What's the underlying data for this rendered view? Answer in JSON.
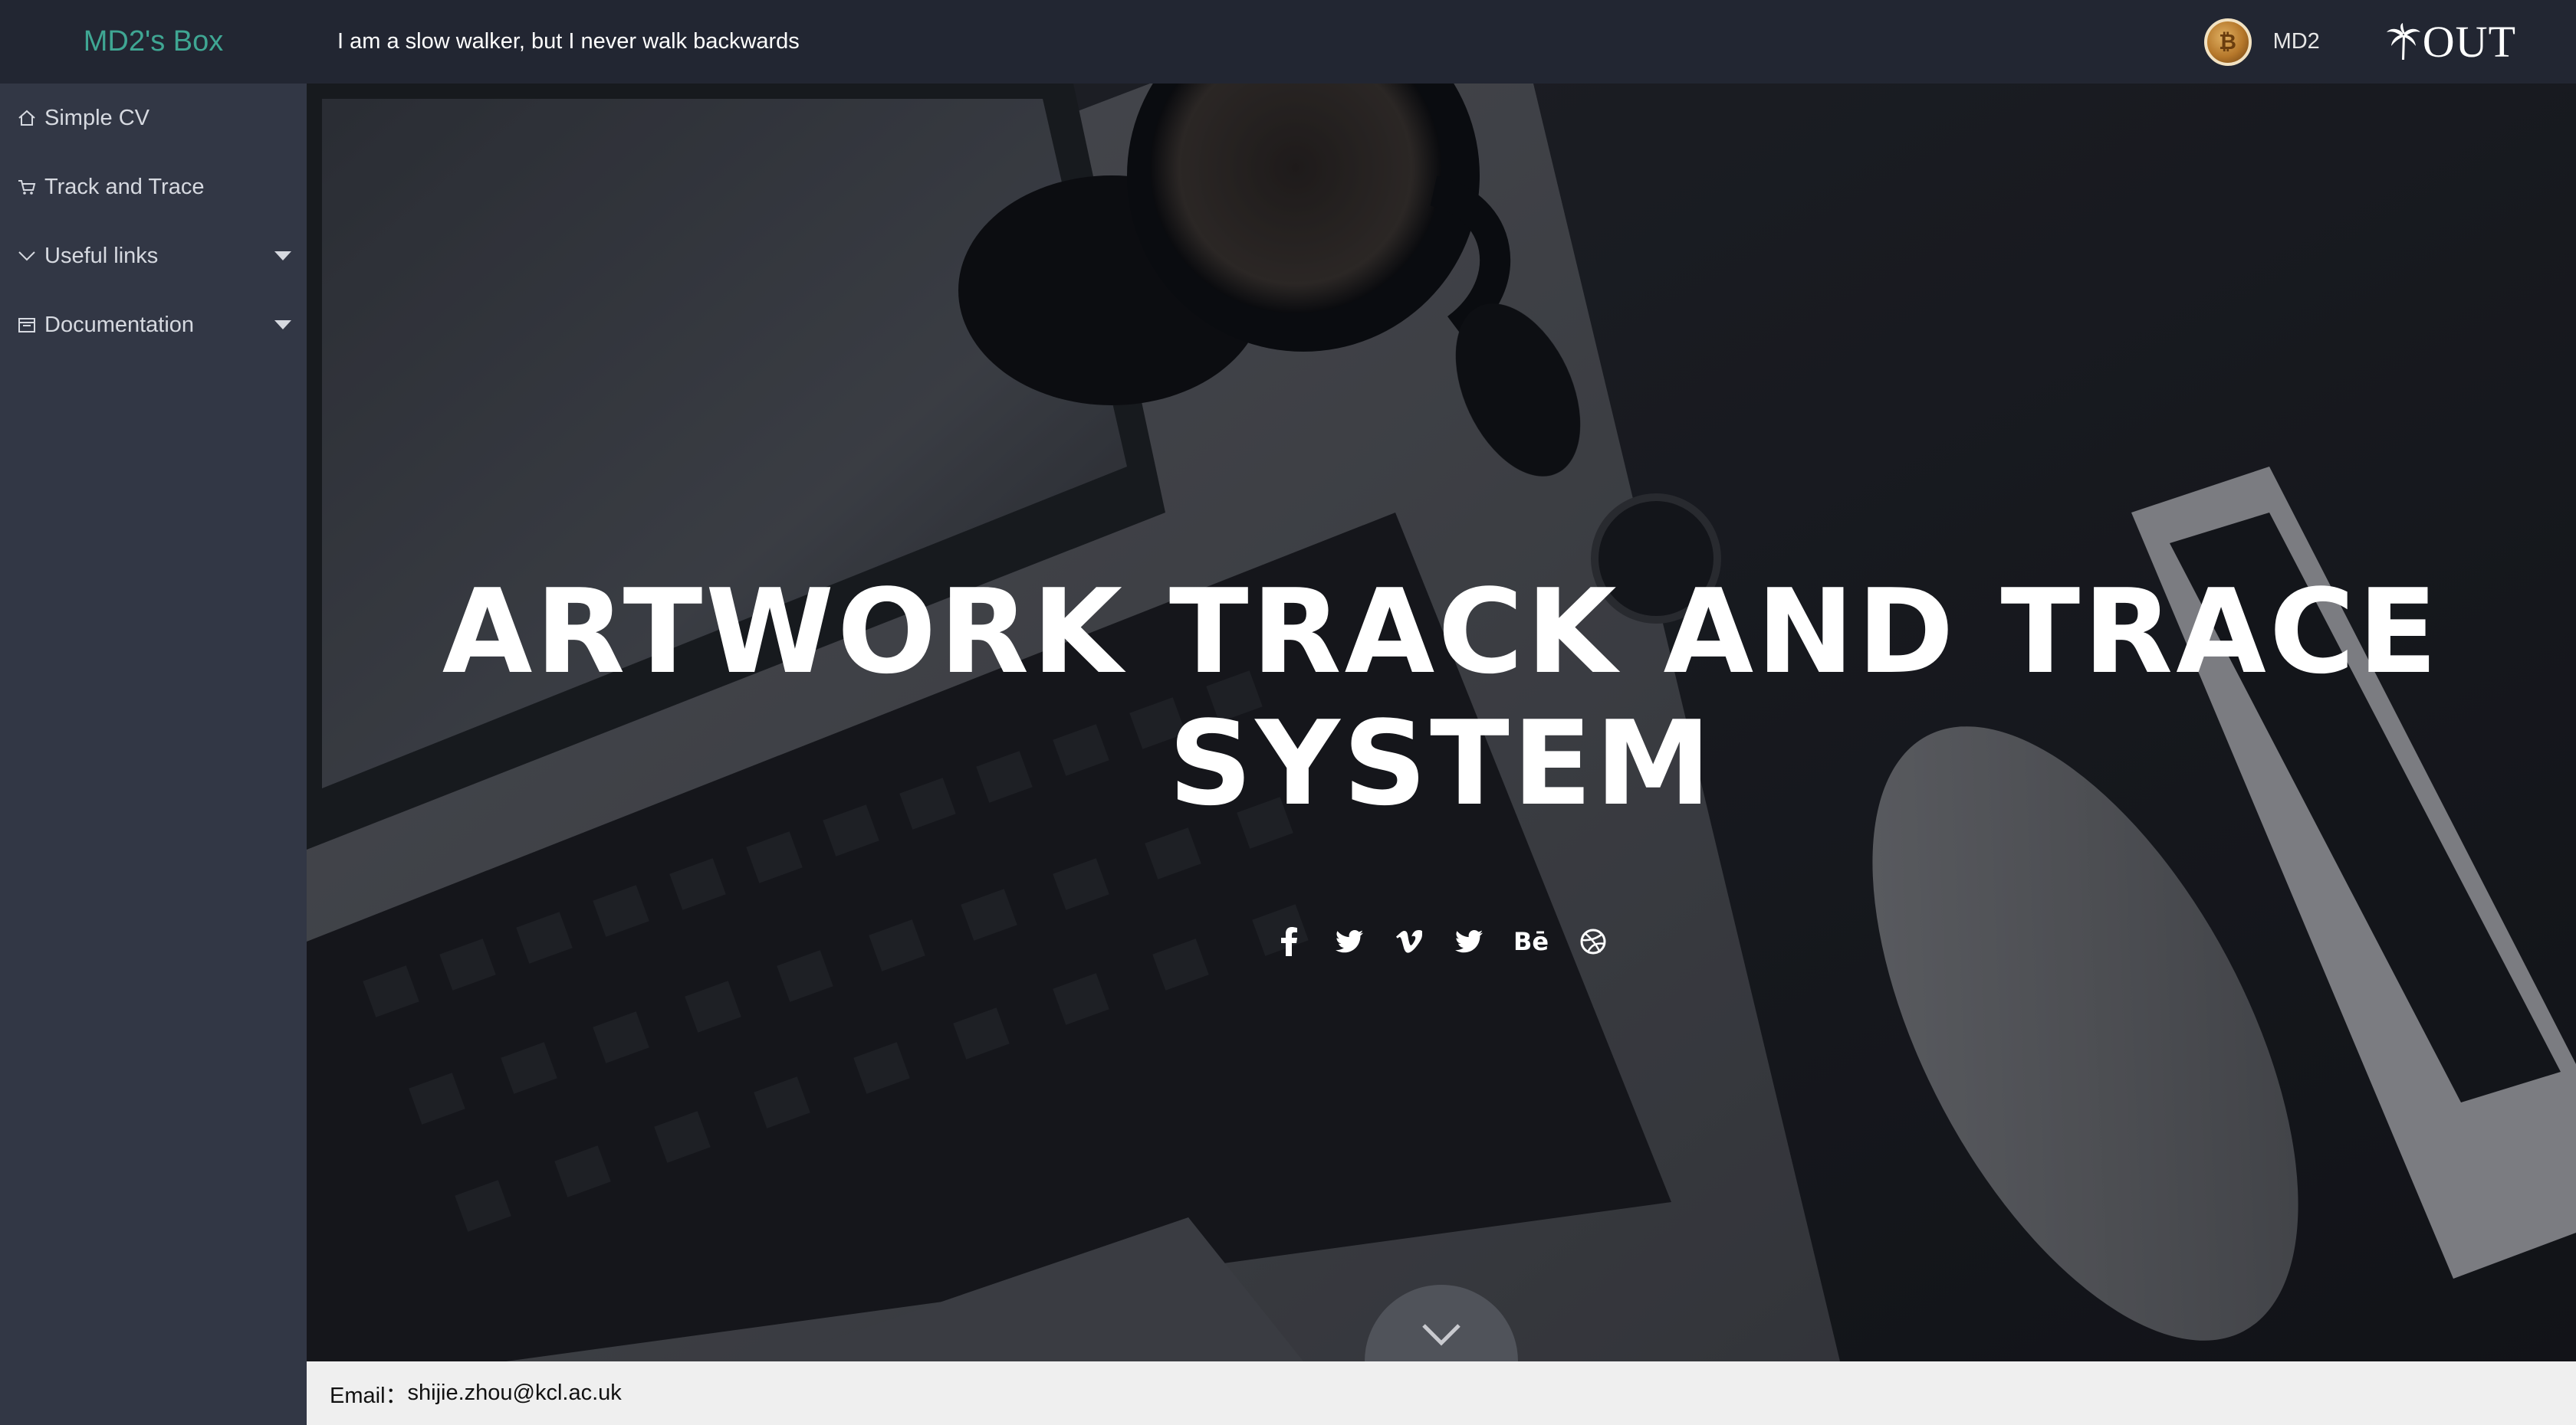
{
  "header": {
    "brand": "MD2's Box",
    "motto": "I am a slow walker, but I never walk backwards",
    "user": {
      "avatar_glyph": "₿",
      "name": "MD2"
    },
    "logout_label": "OUT",
    "logout_icon": "palm-tree-icon"
  },
  "sidebar": {
    "items": [
      {
        "label": "Simple CV",
        "icon": "home-icon",
        "has_submenu": false
      },
      {
        "label": "Track and Trace",
        "icon": "cart-icon",
        "has_submenu": false
      },
      {
        "label": "Useful links",
        "icon": "chevron-down-icon",
        "has_submenu": true
      },
      {
        "label": "Documentation",
        "icon": "calendar-icon",
        "has_submenu": true
      }
    ]
  },
  "hero": {
    "title": "ARTWORK TRACK AND TRACE SYSTEM",
    "social": [
      "facebook-icon",
      "twitter-icon",
      "vimeo-icon",
      "twitter-icon",
      "behance-icon",
      "dribbble-icon"
    ],
    "behance_text": "Bē"
  },
  "footer": {
    "email_label": "Email：",
    "email": "shijie.zhou@kcl.ac.uk"
  },
  "colors": {
    "brand": "#3fa693",
    "topbar": "#222632",
    "sidebar": "#323745",
    "footer": "#efefef"
  }
}
